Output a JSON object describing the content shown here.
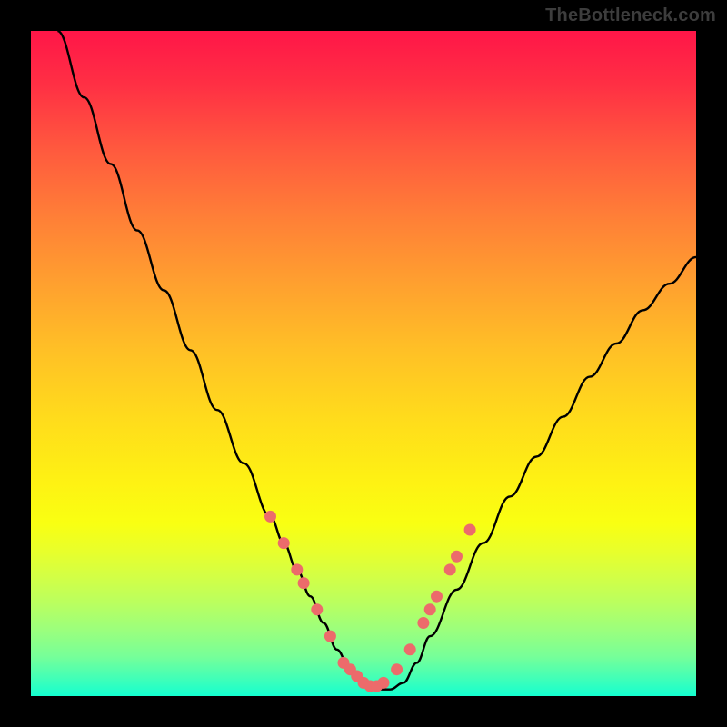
{
  "branding": {
    "text": "TheBottleneck.com"
  },
  "colors": {
    "frame": "#000000",
    "curve": "#000000",
    "marker": "#ec6b6b",
    "gradient_top": "#ff1648",
    "gradient_bottom": "#14ffd0"
  },
  "chart_data": {
    "type": "line",
    "title": "",
    "xlabel": "",
    "ylabel": "",
    "xlim": [
      0,
      100
    ],
    "ylim": [
      0,
      100
    ],
    "grid": false,
    "legend": false,
    "note": "Axes unlabeled; values are approximate pixel-to-percent readings. y=0 is bottom (green), y=100 is top (red). Curve is a V-shaped bottleneck profile with minimum near x≈50.",
    "series": [
      {
        "name": "curve",
        "x": [
          4,
          8,
          12,
          16,
          20,
          24,
          28,
          32,
          36,
          38,
          40,
          42,
          44,
          46,
          48,
          50,
          52,
          54,
          56,
          58,
          60,
          64,
          68,
          72,
          76,
          80,
          84,
          88,
          92,
          96,
          100
        ],
        "y": [
          100,
          90,
          80,
          70,
          61,
          52,
          43,
          35,
          27,
          23,
          19,
          15,
          11,
          7,
          4,
          2,
          1,
          1,
          2,
          5,
          9,
          16,
          23,
          30,
          36,
          42,
          48,
          53,
          58,
          62,
          66
        ]
      }
    ],
    "markers": {
      "name": "highlighted-points",
      "note": "Salmon dots/segments near the trough and lower flanks of the curve.",
      "x": [
        36,
        38,
        40,
        41,
        43,
        45,
        47,
        48,
        49,
        50,
        51,
        52,
        53,
        55,
        57,
        59,
        60,
        61,
        63,
        64,
        66
      ],
      "y": [
        27,
        23,
        19,
        17,
        13,
        9,
        5,
        4,
        3,
        2,
        1.5,
        1.5,
        2,
        4,
        7,
        11,
        13,
        15,
        19,
        21,
        25
      ]
    },
    "background_heatmap": {
      "orientation": "vertical",
      "stops": [
        {
          "pos": 0.0,
          "color": "#ff1648"
        },
        {
          "pos": 0.5,
          "color": "#ffd01f"
        },
        {
          "pos": 0.78,
          "color": "#e9ff2a"
        },
        {
          "pos": 1.0,
          "color": "#14ffd0"
        }
      ]
    }
  }
}
